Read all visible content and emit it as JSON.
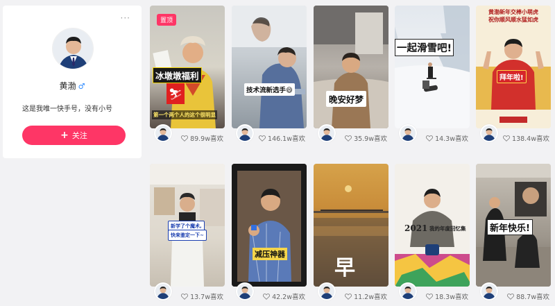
{
  "profile": {
    "name": "黄渤",
    "gender_icon": "male-icon",
    "bio": "这是我唯一快手号，没有小号",
    "follow_label": "关注",
    "more_icon": "more-dots-icon"
  },
  "colors": {
    "accent": "#fe3666",
    "male": "#2f8bff"
  },
  "videos": [
    {
      "likes": "89.9w喜欢",
      "badge": "置顶",
      "caption1": "冰墩墩福利",
      "caption2": "第一个两个人的这个很明显"
    },
    {
      "likes": "146.1w喜欢",
      "caption1": "技术流新选手😄"
    },
    {
      "likes": "35.9w喜欢",
      "caption1": "晚安好梦"
    },
    {
      "likes": "14.3w喜欢",
      "caption1": "一起滑雪吧!"
    },
    {
      "likes": "138.4w喜欢",
      "caption1": "黄渤新年交棒小萌虎",
      "caption2": "祝你顺风顺水猛如虎",
      "caption3": "拜年啦!"
    },
    {
      "likes": "13.7w喜欢",
      "caption1": "新学了个魔术,",
      "caption2": "快来鉴定一下~"
    },
    {
      "likes": "42.2w喜欢",
      "caption1": "减压神器"
    },
    {
      "likes": "11.2w喜欢",
      "caption1": "早"
    },
    {
      "likes": "18.3w喜欢",
      "caption1": "2021",
      "caption2": "我的年度回忆集"
    },
    {
      "likes": "88.7w喜欢",
      "caption1": "新年快乐!"
    }
  ]
}
